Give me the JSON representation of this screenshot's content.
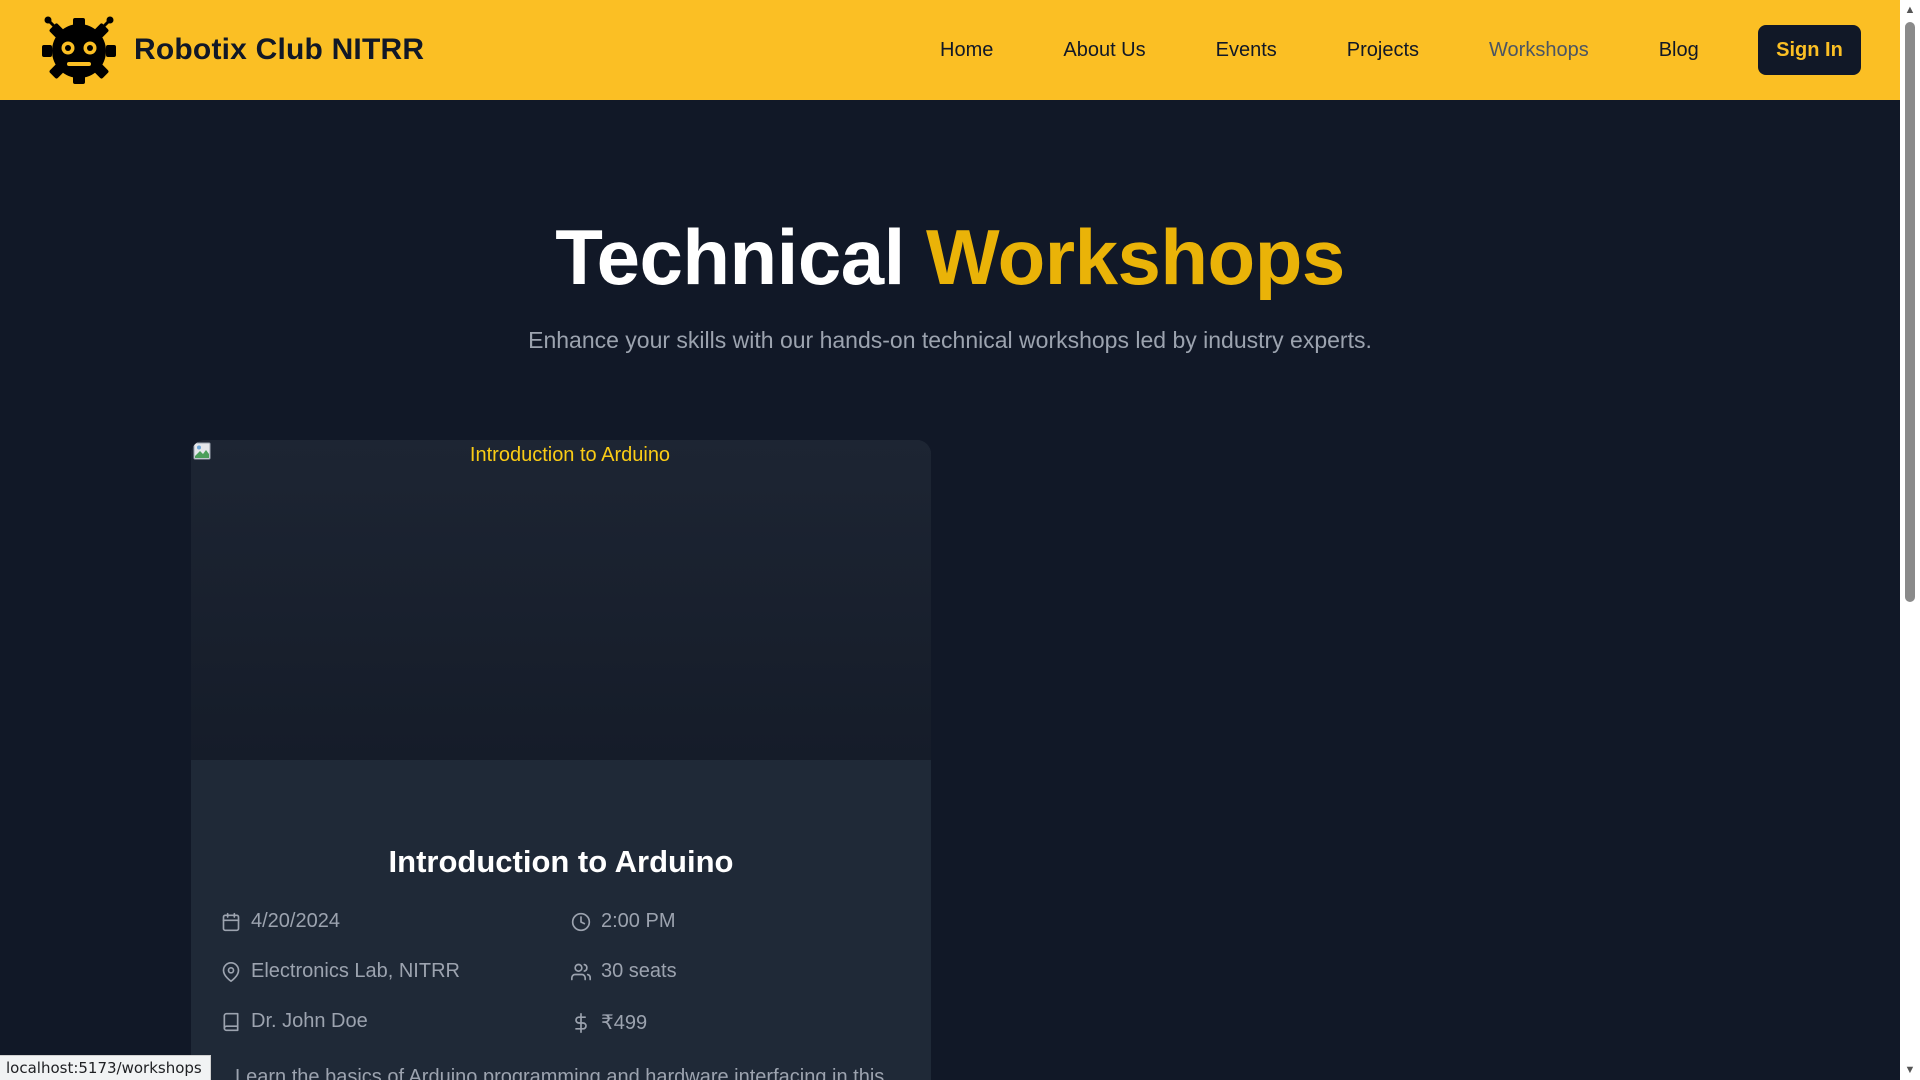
{
  "navbar": {
    "brand": "Robotix Club NITRR",
    "links": [
      "Home",
      "About Us",
      "Events",
      "Projects",
      "Workshops",
      "Blog"
    ],
    "active": "Workshops",
    "signin": "Sign In",
    "background": "#fbbf24"
  },
  "hero": {
    "title_main": "Technical",
    "title_accent": "Workshops",
    "subtitle": "Enhance your skills with our hands-on technical workshops led by industry experts."
  },
  "workshop": {
    "image_alt": "Introduction to Arduino",
    "title": "Introduction to Arduino",
    "date": "4/20/2024",
    "time": "2:00 PM",
    "location": "Electronics Lab, NITRR",
    "seats": "30 seats",
    "instructor": "Dr. John Doe",
    "price": "₹499",
    "description": "Learn the basics of Arduino programming and hardware interfacing in this"
  },
  "status_bar": {
    "url": "localhost:5173/workshops"
  },
  "colors": {
    "accent": "#eab308",
    "background": "#111827",
    "card": "#1f2937"
  }
}
